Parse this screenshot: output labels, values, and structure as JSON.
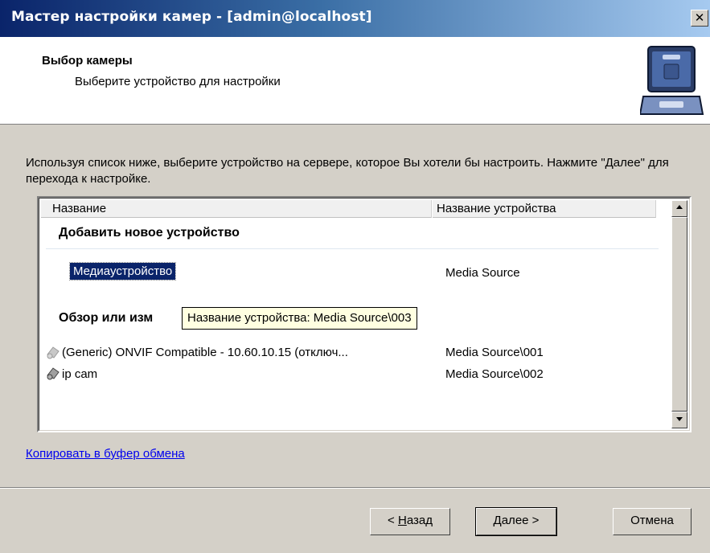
{
  "window": {
    "title": "Мастер настройки камер - [admin@localhost]",
    "close_glyph": "✕"
  },
  "header": {
    "title": "Выбор камеры",
    "subtitle": "Выберите устройство для настройки",
    "icon": "camera-device-icon"
  },
  "intro_text": "Используя список ниже, выберите устройство на сервере, которое Вы хотели бы настроить. Нажмите \"Далее\" для перехода к настройке.",
  "list": {
    "columns": [
      "Название",
      "Название устройства"
    ],
    "group_add": "Добавить новое устройство",
    "add_item": {
      "name": "Медиаустройство",
      "device": "Media Source"
    },
    "group_existing": "Обзор или изм",
    "items": [
      {
        "name": "(Generic) ONVIF Compatible - 10.60.10.15 (отключ...",
        "device": "Media Source\\001",
        "icon": "camera-gray-icon"
      },
      {
        "name": "ip cam",
        "device": "Media Source\\002",
        "icon": "camera-icon"
      }
    ]
  },
  "tooltip": "Название устройства: Media Source\\003",
  "copy_link": "Копировать в буфер обмена",
  "buttons": {
    "back": {
      "prefix": "< ",
      "mnemonic": "Н",
      "rest": "азад"
    },
    "next": {
      "mnemonic": "Д",
      "rest": "алее >"
    },
    "cancel": "Отмена"
  }
}
